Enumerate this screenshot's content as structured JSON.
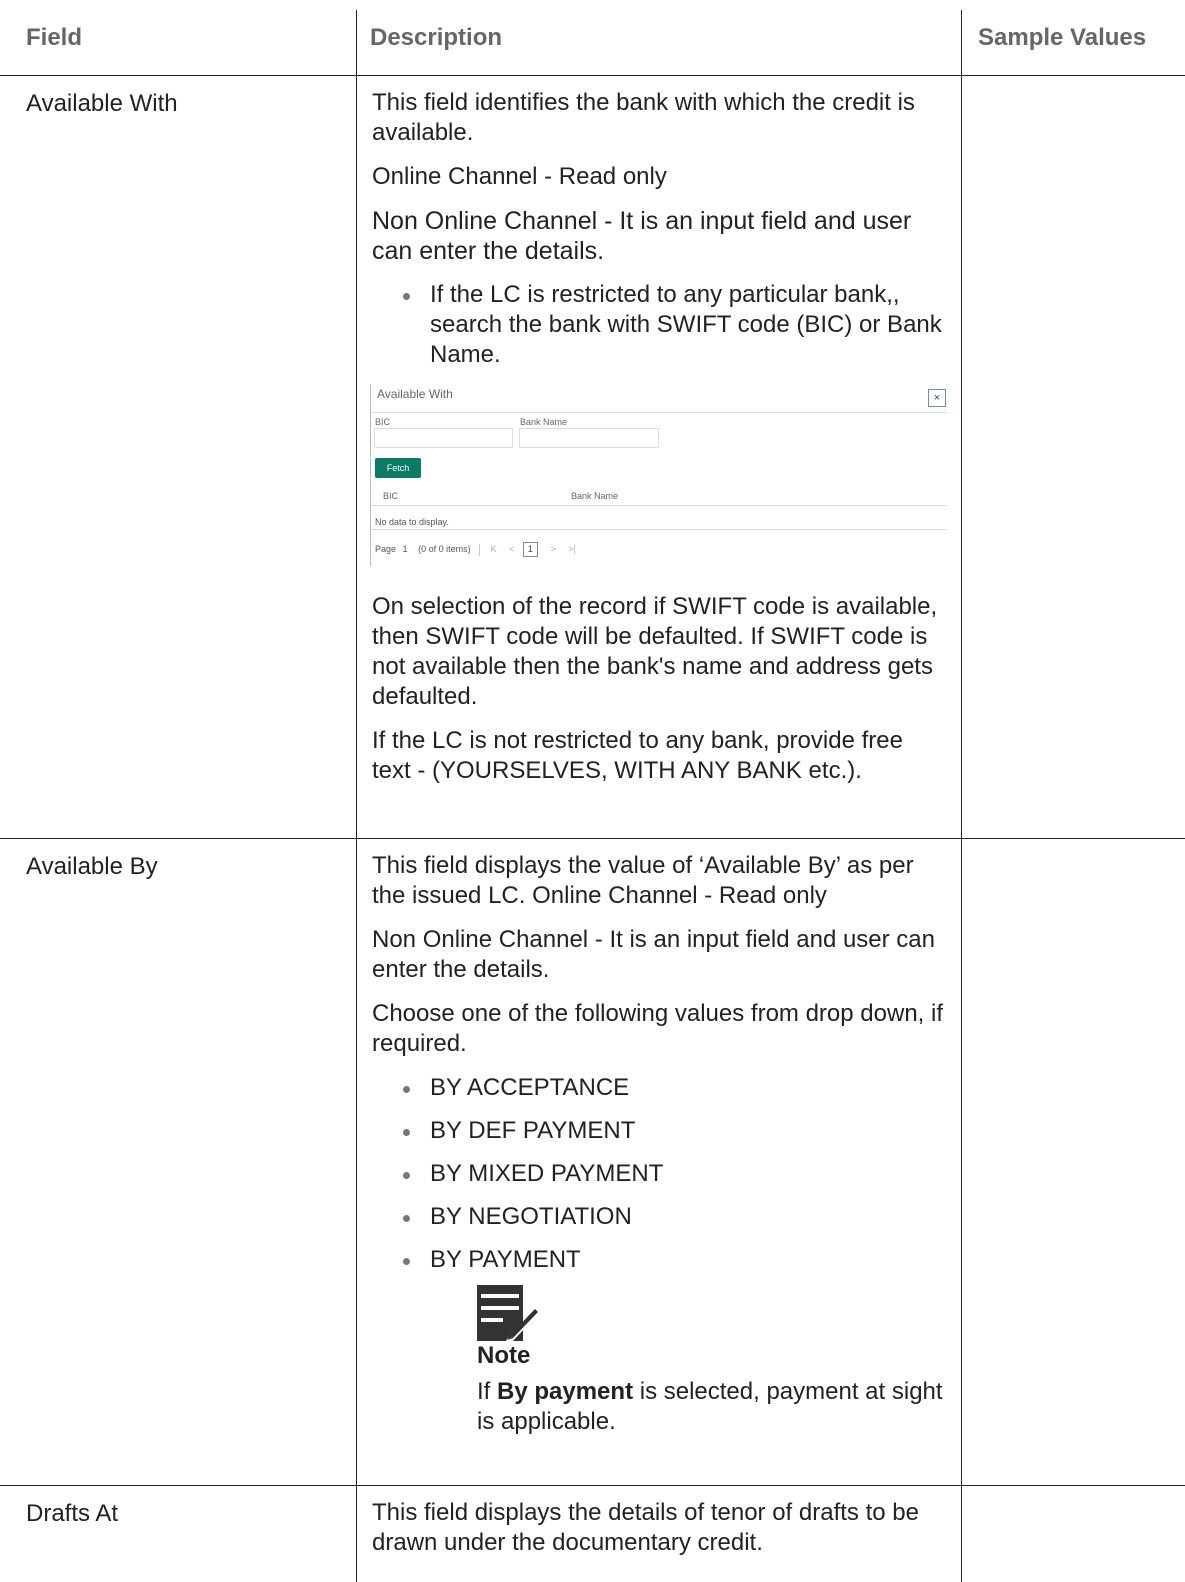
{
  "header": {
    "field": "Field",
    "description": "Description",
    "sample_values": "Sample Values"
  },
  "rows": [
    {
      "field": "Available With",
      "p1": "This field identifies the bank with which the credit is available.",
      "p2": "Online Channel - Read only",
      "p3": "Non Online Channel - It is an input field and user can enter the details.",
      "bullet": "If the LC is restricted to any particular bank,, search the bank with SWIFT code (BIC) or Bank Name.",
      "dialog": {
        "title": "Available With",
        "close": "×",
        "bic_label": "BIC",
        "bank_name_label": "Bank Name",
        "fetch": "Fetch",
        "col_bic": "BIC",
        "col_bank_name": "Bank Name",
        "no_data": "No data to display.",
        "page_label": "Page",
        "page_num": "1",
        "items": "(0 of 0 items)",
        "first": "K",
        "prev": "<",
        "current": "1",
        "next": ">",
        "last": ">|"
      },
      "p4": "On selection of the record if SWIFT code is available, then SWIFT code will be defaulted. If SWIFT code is not available then the bank's name and address gets defaulted.",
      "p5": "If the LC is not restricted to any bank, provide free text - (YOURSELVES, WITH ANY BANK etc.)."
    },
    {
      "field": "Available By",
      "p1": "This field displays the value of ‘Available By’ as per the issued LC. Online Channel - Read only",
      "p2": "Non Online Channel - It is an input field and user can enter the details.",
      "p3": "Choose one of the following values from drop down, if required.",
      "options": [
        "BY ACCEPTANCE",
        "BY DEF PAYMENT",
        "BY MIXED PAYMENT",
        "BY NEGOTIATION",
        "BY PAYMENT"
      ],
      "note_title": "Note",
      "note_pre": " If ",
      "note_bold": "By payment",
      "note_post": " is selected, payment at sight is applicable."
    },
    {
      "field": "Drafts At",
      "p1": "This field displays the details of tenor of drafts to be drawn under the documentary credit."
    }
  ]
}
